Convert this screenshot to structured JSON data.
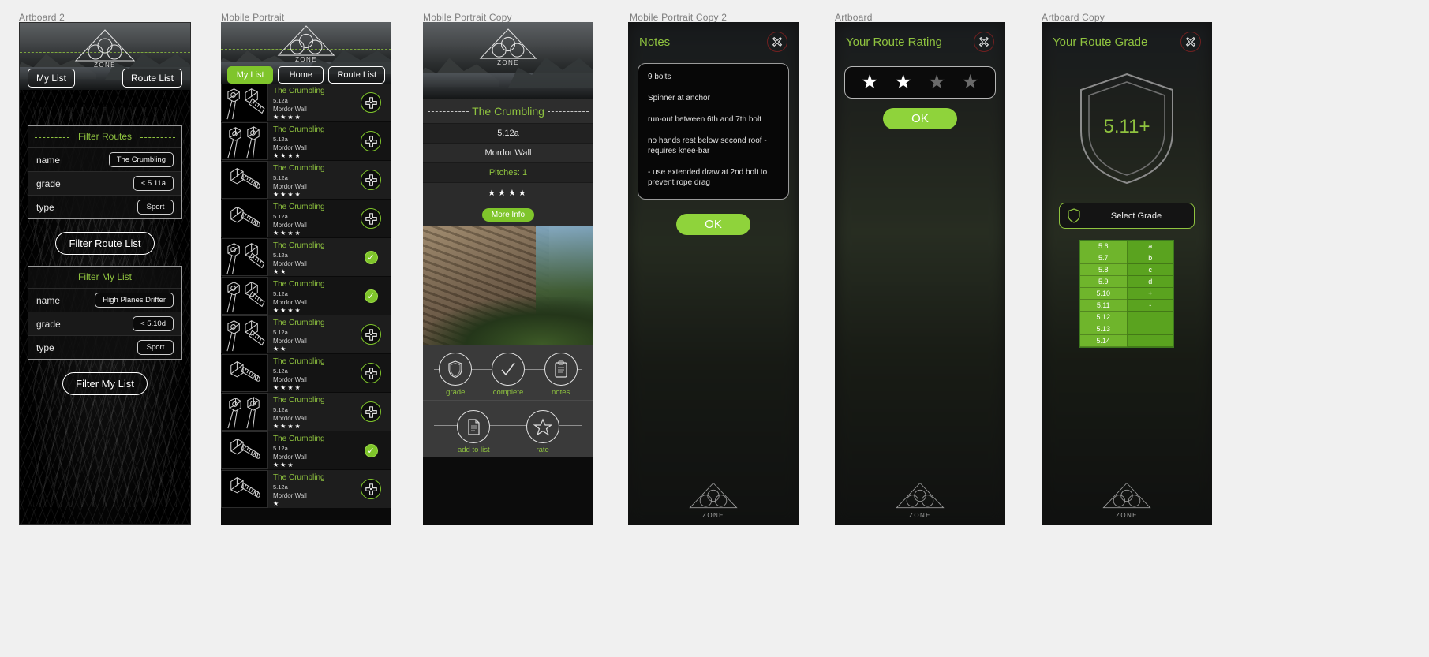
{
  "artboards": {
    "a2": "Artboard 2",
    "a3": "Mobile Portrait",
    "a4": "Mobile Portrait Copy",
    "a5": "Mobile Portrait Copy 2",
    "a6": "Artboard",
    "a7": "Artboard Copy"
  },
  "brand": {
    "logo_word": "ZONE",
    "accent": "#8fc33f",
    "green_button": "#7fc52b",
    "close_red": "#6f2020"
  },
  "filters_screen": {
    "nav": {
      "my_list": "My List",
      "route_list": "Route List"
    },
    "route_filter": {
      "title": "Filter Routes",
      "rows": [
        {
          "label": "name",
          "value": "The Crumbling"
        },
        {
          "label": "grade",
          "value": "< 5.11a"
        },
        {
          "label": "type",
          "value": "Sport"
        }
      ],
      "action": "Filter Route List"
    },
    "my_list_filter": {
      "title": "Filter My List",
      "rows": [
        {
          "label": "name",
          "value": "High Planes Drifter"
        },
        {
          "label": "grade",
          "value": "< 5.10d"
        },
        {
          "label": "type",
          "value": "Sport"
        }
      ],
      "action": "Filter My List"
    }
  },
  "list_screen": {
    "nav": [
      {
        "label": "My List",
        "active": true
      },
      {
        "label": "Home",
        "active": false
      },
      {
        "label": "Route List",
        "active": false
      }
    ],
    "add_icon": "plus-icon",
    "check_icon": "check-icon",
    "rows": [
      {
        "name": "The Crumbling",
        "grade": "5.12a",
        "wall": "Mordor Wall",
        "stars": 4,
        "completed": false,
        "thumb": "bolt-hanger-pair"
      },
      {
        "name": "The Crumbling",
        "grade": "5.12a",
        "wall": "Mordor Wall",
        "stars": 4,
        "completed": false,
        "thumb": "two-hangers"
      },
      {
        "name": "The Crumbling",
        "grade": "5.12a",
        "wall": "Mordor Wall",
        "stars": 4,
        "completed": false,
        "thumb": "single-bolt"
      },
      {
        "name": "The Crumbling",
        "grade": "5.12a",
        "wall": "Mordor Wall",
        "stars": 4,
        "completed": false,
        "thumb": "single-bolt"
      },
      {
        "name": "The Crumbling",
        "grade": "5.12a",
        "wall": "Mordor Wall",
        "stars": 2,
        "completed": true,
        "thumb": "bolt-hanger-pair"
      },
      {
        "name": "The Crumbling",
        "grade": "5.12a",
        "wall": "Mordor Wall",
        "stars": 4,
        "completed": true,
        "thumb": "bolt-hanger-pair"
      },
      {
        "name": "The Crumbling",
        "grade": "5.12a",
        "wall": "Mordor Wall",
        "stars": 2,
        "completed": false,
        "thumb": "bolt-hanger-pair"
      },
      {
        "name": "The Crumbling",
        "grade": "5.12a",
        "wall": "Mordor Wall",
        "stars": 4,
        "completed": false,
        "thumb": "single-bolt"
      },
      {
        "name": "The Crumbling",
        "grade": "5.12a",
        "wall": "Mordor Wall",
        "stars": 4,
        "completed": false,
        "thumb": "two-hangers"
      },
      {
        "name": "The Crumbling",
        "grade": "5.12a",
        "wall": "Mordor Wall",
        "stars": 3,
        "completed": true,
        "thumb": "single-bolt"
      },
      {
        "name": "The Crumbling",
        "grade": "5.12a",
        "wall": "Mordor Wall",
        "stars": 1,
        "completed": false,
        "thumb": "single-bolt"
      }
    ]
  },
  "detail_screen": {
    "title": "The Crumbling",
    "grade": "5.12a",
    "wall": "Mordor Wall",
    "pitches": "Pitches: 1",
    "stars": 4,
    "more_info": "More Info",
    "actions_top": [
      {
        "label": "grade",
        "icon": "shield-icon"
      },
      {
        "label": "complete",
        "icon": "check-icon"
      },
      {
        "label": "notes",
        "icon": "clipboard-icon"
      }
    ],
    "actions_bottom": [
      {
        "label": "add to list",
        "icon": "document-icon"
      },
      {
        "label": "rate",
        "icon": "star-icon"
      }
    ]
  },
  "notes_screen": {
    "title": "Notes",
    "close_icon": "close-icon",
    "lines": [
      "9 bolts",
      "Spinner at anchor",
      "run-out between 6th and 7th bolt",
      "no hands rest below second roof - requires knee-bar",
      " - use extended draw at 2nd bolt to prevent rope drag"
    ],
    "ok": "OK"
  },
  "rating_screen": {
    "title": "Your Route Rating",
    "close_icon": "close-icon",
    "stars_total": 4,
    "stars_selected": 2,
    "ok": "OK"
  },
  "grade_screen": {
    "title": "Your Route Grade",
    "close_icon": "close-icon",
    "grade_value": "5.11+",
    "shield_icon": "shield-icon",
    "select_label": "Select Grade",
    "grade_table": [
      {
        "left": "5.6",
        "right": "a"
      },
      {
        "left": "5.7",
        "right": "b"
      },
      {
        "left": "5.8",
        "right": "c"
      },
      {
        "left": "5.9",
        "right": "d"
      },
      {
        "left": "5.10",
        "right": "+"
      },
      {
        "left": "5.11",
        "right": "-"
      },
      {
        "left": "5.12",
        "right": ""
      },
      {
        "left": "5.13",
        "right": ""
      },
      {
        "left": "5.14",
        "right": ""
      }
    ]
  }
}
